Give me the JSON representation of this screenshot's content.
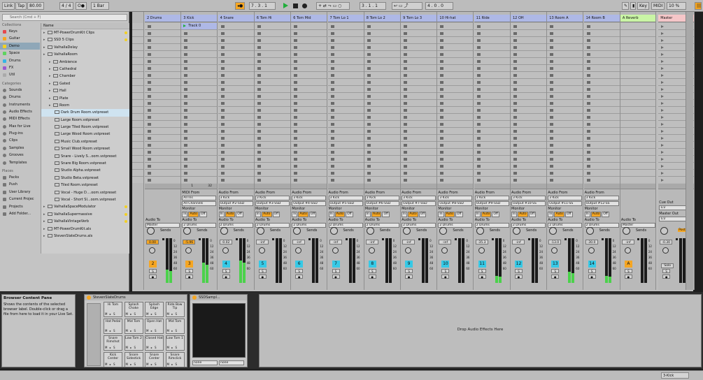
{
  "topbar": {
    "link": "Link",
    "tap": "Tap",
    "tempo": "80.00",
    "sig": "4 / 4",
    "metro": "O●",
    "quant": "1 Bar",
    "pos": "7 . 3 . 1",
    "loop_start": "3 . 1 . 1",
    "loop_len": "4 . 0 . 0",
    "key": "Key",
    "midi": "MIDI",
    "cpu": "10 %"
  },
  "browser": {
    "search_placeholder": "Search (Cmd + F)",
    "collections_header": "Collections",
    "collections": [
      {
        "label": "Keys",
        "color": "#e5484d"
      },
      {
        "label": "Guitar",
        "color": "#f5a623"
      },
      {
        "label": "Demo",
        "color": "#f2d024"
      },
      {
        "label": "Space",
        "color": "#5fd35f"
      },
      {
        "label": "Drums",
        "color": "#35b5e5"
      },
      {
        "label": "FX",
        "color": "#9b59d0"
      },
      {
        "label": "Util",
        "color": "#aaaaaa"
      }
    ],
    "categories_header": "Categories",
    "categories": [
      "Sounds",
      "Drums",
      "Instruments",
      "Audio Effects",
      "MIDI Effects",
      "Max for Live",
      "Plug-ins",
      "Clips",
      "Samples",
      "Grooves",
      "Templates"
    ],
    "places_header": "Places",
    "places": [
      "Packs",
      "Push",
      "User Library",
      "Current Projec",
      "Projects",
      "Add Folder..."
    ],
    "name_header": "Name",
    "tree": [
      {
        "label": "MT-PowerDrumKit Clips",
        "lvl": 0,
        "dot": "#f2d024"
      },
      {
        "label": "SSD 5 Clips",
        "lvl": 0,
        "dot": "#f2d024"
      },
      {
        "label": "ValhallaDelay",
        "lvl": 0,
        "dot": ""
      },
      {
        "label": "ValhallaRoom",
        "lvl": 0,
        "dot": ""
      },
      {
        "label": "Ambience",
        "lvl": 1,
        "dot": ""
      },
      {
        "label": "Cathedral",
        "lvl": 1,
        "dot": ""
      },
      {
        "label": "Chamber",
        "lvl": 1,
        "dot": ""
      },
      {
        "label": "Gated",
        "lvl": 1,
        "dot": ""
      },
      {
        "label": "Hall",
        "lvl": 1,
        "dot": ""
      },
      {
        "label": "Plate",
        "lvl": 1,
        "dot": ""
      },
      {
        "label": "Room",
        "lvl": 1,
        "dot": ""
      },
      {
        "label": "Dark Drum Room.vstpreset",
        "lvl": 2,
        "dot": ""
      },
      {
        "label": "Large Room.vstpreset",
        "lvl": 2,
        "dot": ""
      },
      {
        "label": "Large Tiled Room.vstpreset",
        "lvl": 2,
        "dot": ""
      },
      {
        "label": "Large Wood Room.vstpreset",
        "lvl": 2,
        "dot": ""
      },
      {
        "label": "Music Club.vstpreset",
        "lvl": 2,
        "dot": ""
      },
      {
        "label": "Small Wood Room.vstpreset",
        "lvl": 2,
        "dot": ""
      },
      {
        "label": "Snare - Lively S...oom.vstpreset",
        "lvl": 2,
        "dot": ""
      },
      {
        "label": "Snare Big Room.vstpreset",
        "lvl": 2,
        "dot": ""
      },
      {
        "label": "Studio Alpha.vstpreset",
        "lvl": 2,
        "dot": ""
      },
      {
        "label": "Studio Beta.vstpreset",
        "lvl": 2,
        "dot": ""
      },
      {
        "label": "Tiled Room.vstpreset",
        "lvl": 2,
        "dot": ""
      },
      {
        "label": "Vocal - Huge D....oom.vstpreset",
        "lvl": 2,
        "dot": ""
      },
      {
        "label": "Vocal - Short Sl...oom.vstpreset",
        "lvl": 2,
        "dot": ""
      },
      {
        "label": "ValhallaSpaceModulator",
        "lvl": 0,
        "dot": "#f2d024"
      },
      {
        "label": "ValhallaSupermassive",
        "lvl": 0,
        "dot": "#f2d024"
      },
      {
        "label": "ValhallaVintageVerb",
        "lvl": 0,
        "dot": "#f2d024"
      },
      {
        "label": "MT-PowerDrumKit.als",
        "lvl": 0,
        "dot": ""
      },
      {
        "label": "StevenSlateDrums.als",
        "lvl": 0,
        "dot": ""
      }
    ]
  },
  "tracks": [
    {
      "name": "2 Drums",
      "num": "2",
      "vol": "0.00",
      "color": "#aeb8e6",
      "in_from": "",
      "in_ch": "",
      "audio_to": "Master",
      "meter": "0.30"
    },
    {
      "name": "3 Kick",
      "num": "3",
      "vol": "-5.96",
      "color": "#aeb8e6",
      "in_from": "All Ins",
      "in_ch": "All Channels",
      "audio_to": "2 Drums",
      "meter": "0.45"
    },
    {
      "name": "4 Snare",
      "num": "4",
      "vol": "-0.02",
      "color": "#aeb8e6",
      "in_from": "3 Kick",
      "in_ch": "Output #2-SSD",
      "audio_to": "2 Drums",
      "meter": "0.50"
    },
    {
      "name": "6 Tom Hi",
      "num": "5",
      "vol": "-inf",
      "color": "#aeb8e6",
      "in_from": "3 Kick",
      "in_ch": "Output #3-SSD",
      "audio_to": "2 Drums",
      "meter": "0.0"
    },
    {
      "name": "6 Tom Mid",
      "num": "6",
      "vol": "-inf",
      "color": "#aeb8e6",
      "in_from": "3 Kick",
      "in_ch": "Output #4-SSD",
      "audio_to": "2 Drums",
      "meter": "0.0"
    },
    {
      "name": "7 Tom Lo 1",
      "num": "7",
      "vol": "-inf",
      "color": "#aeb8e6",
      "in_from": "3 Kick",
      "in_ch": "Output #5-SSD",
      "audio_to": "2 Drums",
      "meter": "0.0"
    },
    {
      "name": "8 Tom Lo 2",
      "num": "8",
      "vol": "-inf",
      "color": "#aeb8e6",
      "in_from": "3 Kick",
      "in_ch": "Output #6-SSD",
      "audio_to": "2 Drums",
      "meter": "0.0"
    },
    {
      "name": "9 Tom Lo 3",
      "num": "9",
      "vol": "-inf",
      "color": "#aeb8e6",
      "in_from": "3 Kick",
      "in_ch": "Output #7-SSD",
      "audio_to": "2 Drums",
      "meter": "0.0"
    },
    {
      "name": "10 Hi-hat",
      "num": "10",
      "vol": "-inf",
      "color": "#aeb8e6",
      "in_from": "3 Kick",
      "in_ch": "Output #8-SSD",
      "audio_to": "2 Drums",
      "meter": "0.0"
    },
    {
      "name": "11 Ride",
      "num": "11",
      "vol": "-35.3",
      "color": "#aeb8e6",
      "in_from": "3 Kick",
      "in_ch": "Output #9-SSD",
      "audio_to": "2 Drums",
      "meter": "0.15"
    },
    {
      "name": "12 OH",
      "num": "12",
      "vol": "-inf",
      "color": "#aeb8e6",
      "in_from": "3 Kick",
      "in_ch": "Output #10-SS",
      "audio_to": "2 Drums",
      "meter": "0.0"
    },
    {
      "name": "13 Room A",
      "num": "13",
      "vol": "-13.0",
      "color": "#aeb8e6",
      "in_from": "3 Kick",
      "in_ch": "Output #11-SS",
      "audio_to": "2 Drums",
      "meter": "0.25"
    },
    {
      "name": "14 Room B",
      "num": "14",
      "vol": "-30.0",
      "color": "#aeb8e6",
      "in_from": "3 Kick",
      "in_ch": "Output #12-SS",
      "audio_to": "2 Drums",
      "meter": "0.15"
    }
  ],
  "clip": {
    "name": "Track 0"
  },
  "returns": {
    "name": "A Reverb",
    "vol": "-inf",
    "letter": "A",
    "audio_to": "Master",
    "color": "#c9f5a5"
  },
  "master": {
    "name": "Master",
    "vol": "-0.30",
    "post": "Post",
    "solo": "Solo",
    "cue_out": "Cue Out",
    "cue_val": "1/2",
    "out_label": "Master Out",
    "out_val": "1/2",
    "color": "#f5c6c8"
  },
  "scenes": [
    "1",
    "2",
    "3",
    "4",
    "5",
    "6",
    "7",
    "8",
    "9",
    "10",
    "11",
    "12",
    "13",
    "14",
    "15",
    "16",
    "17",
    "18",
    "19",
    "20",
    "21",
    "22",
    "23"
  ],
  "labels": {
    "midi_from": "MIDI From",
    "audio_from": "Audio From",
    "monitor": "Monitor",
    "in": "In",
    "auto": "Auto",
    "off": "Off",
    "audio_to": "Audio To",
    "sends": "Sends",
    "midi_val1": "1",
    "midi_val2": "32"
  },
  "info": {
    "title": "Browser Content Pane",
    "body": "Shows the contents of the selected browser label. Double-click or drag a file from here to load it in your Live Set."
  },
  "drumrack": {
    "name": "StevenSlateDrums",
    "pads": [
      "Hi Tom",
      "Splash Choke",
      "Splash Edge",
      "Ride Bow Tip",
      "Hat Pedal",
      "Mid Tom",
      "Open Hat",
      "Mid Tom",
      "Snare Rimshot",
      "Low Tom 2",
      "Closed Hat",
      "Low Tom 1",
      "Kick Center",
      "Snare Sidestick",
      "Snare Center",
      "Snare Rimclick"
    ]
  },
  "sampler": {
    "name": "SSDSampl...",
    "in1": "none",
    "in2": "none"
  },
  "drop": "Drop Audio Effects Here",
  "status": {
    "track": "3-Kick"
  },
  "colors": {
    "accent": "#f5a623",
    "track_num": "#36c9e6",
    "meter": "#4bd24b"
  }
}
